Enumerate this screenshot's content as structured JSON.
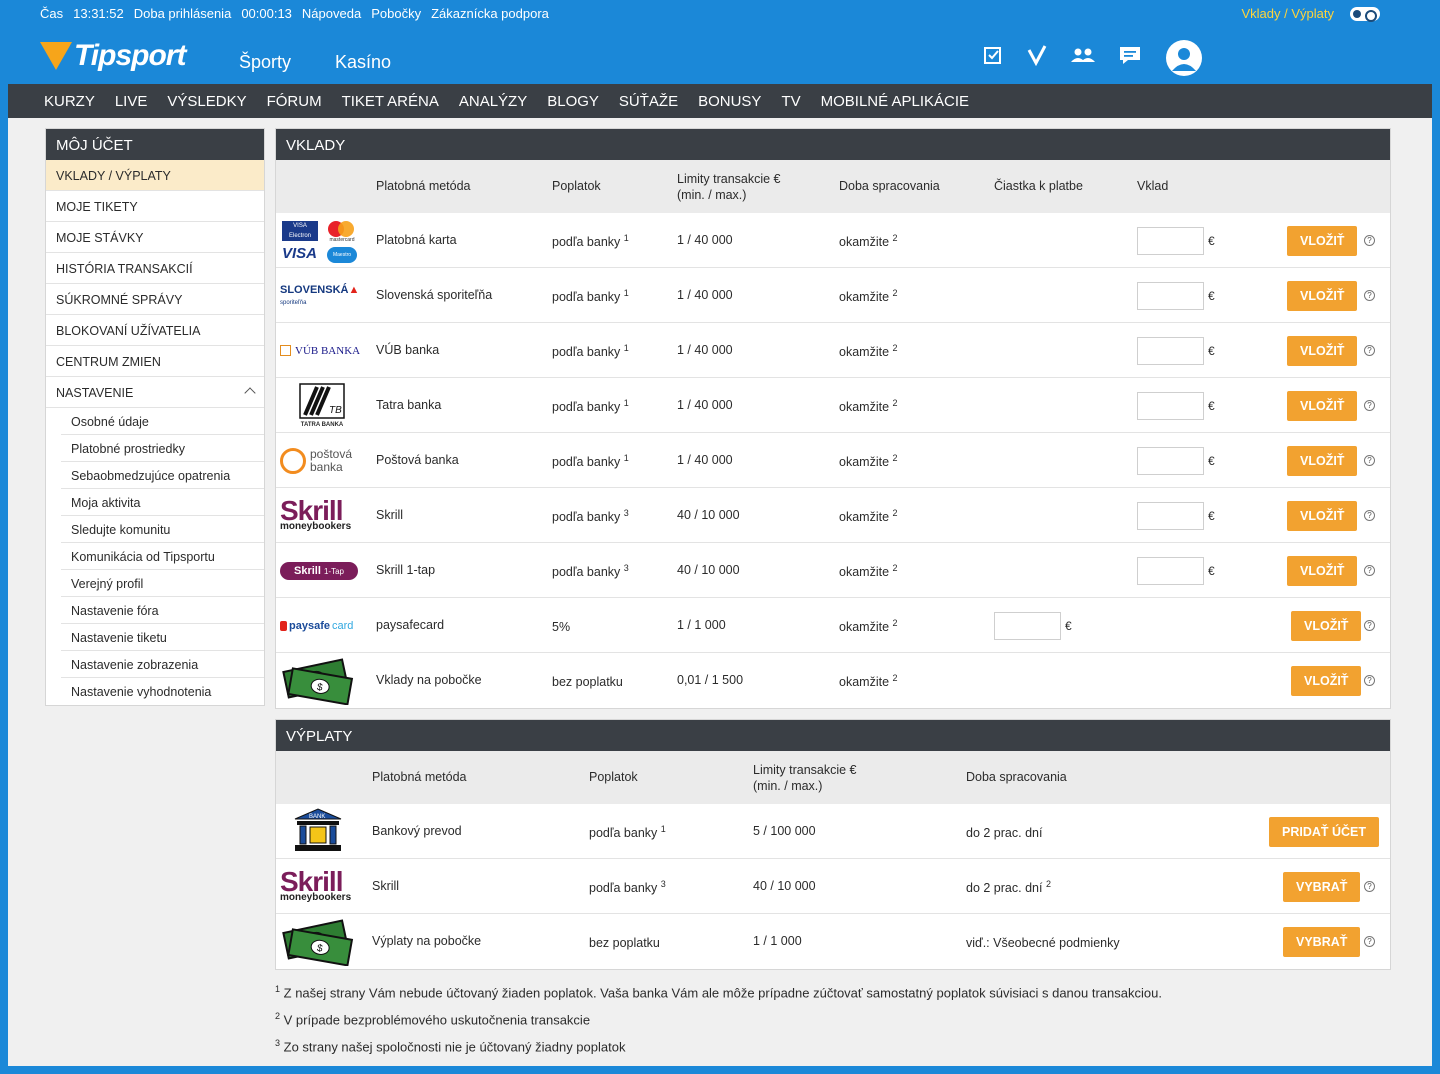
{
  "topbar": {
    "time_label": "Čas",
    "time_value": "13:31:52",
    "session_label": "Doba prihlásenia",
    "session_value": "00:00:13",
    "help": "Nápoveda",
    "branches": "Pobočky",
    "support": "Zákaznícka podpora",
    "deposits_link": "Vklady / Výplaty"
  },
  "logo": {
    "text": "Tipsport"
  },
  "mainnav": {
    "sports": "Športy",
    "casino": "Kasíno"
  },
  "subnav": [
    "KURZY",
    "LIVE",
    "VÝSLEDKY",
    "FÓRUM",
    "TIKET ARÉNA",
    "ANALÝZY",
    "BLOGY",
    "SÚŤAŽE",
    "BONUSY",
    "TV",
    "MOBILNÉ APLIKÁCIE"
  ],
  "sidebar": {
    "title": "MÔJ ÚČET",
    "items": [
      "VKLADY / VÝPLATY",
      "MOJE TIKETY",
      "MOJE STÁVKY",
      "HISTÓRIA TRANSAKCIÍ",
      "SÚKROMNÉ SPRÁVY",
      "BLOKOVANÍ UŽÍVATELIA",
      "CENTRUM ZMIEN",
      "NASTAVENIE"
    ],
    "subitems": [
      "Osobné údaje",
      "Platobné prostriedky",
      "Sebaobmedzujúce opatrenia",
      "Moja aktivita",
      "Sledujte komunitu",
      "Komunikácia od Tipsportu",
      "Verejný profil",
      "Nastavenie fóra",
      "Nastavenie tiketu",
      "Nastavenie zobrazenia",
      "Nastavenie vyhodnotenia"
    ]
  },
  "deposits": {
    "title": "VKLADY",
    "headers": {
      "method": "Platobná metóda",
      "fee": "Poplatok",
      "limits_line1": "Limity transakcie €",
      "limits_line2": "(min. / max.)",
      "processing": "Doba spracovania",
      "amount": "Čiastka k platbe",
      "deposit": "Vklad"
    },
    "rows": [
      {
        "logo": "card-logo",
        "method": "Platobná karta",
        "fee": "podľa banky",
        "fee_note": "1",
        "limits": "1 / 40 000",
        "processing": "okamžite",
        "proc_note": "2"
      },
      {
        "logo": "slsp-logo",
        "method": "Slovenská sporiteľňa",
        "fee": "podľa banky",
        "fee_note": "1",
        "limits": "1 / 40 000",
        "processing": "okamžite",
        "proc_note": "2"
      },
      {
        "logo": "vub-logo",
        "method": "VÚB banka",
        "fee": "podľa banky",
        "fee_note": "1",
        "limits": "1 / 40 000",
        "processing": "okamžite",
        "proc_note": "2"
      },
      {
        "logo": "tatra-logo",
        "method": "Tatra banka",
        "fee": "podľa banky",
        "fee_note": "1",
        "limits": "1 / 40 000",
        "processing": "okamžite",
        "proc_note": "2"
      },
      {
        "logo": "postova-logo",
        "method": "Poštová banka",
        "fee": "podľa banky",
        "fee_note": "1",
        "limits": "1 / 40 000",
        "processing": "okamžite",
        "proc_note": "2"
      },
      {
        "logo": "skrill-logo",
        "method": "Skrill",
        "fee": "podľa banky",
        "fee_note": "3",
        "limits": "40 / 10 000",
        "processing": "okamžite",
        "proc_note": "2"
      },
      {
        "logo": "skrill-1tap-logo",
        "method": "Skrill 1-tap",
        "fee": "podľa banky",
        "fee_note": "3",
        "limits": "40 / 10 000",
        "processing": "okamžite",
        "proc_note": "2"
      },
      {
        "logo": "paysafecard-logo",
        "method": "paysafecard",
        "fee": "5%",
        "fee_note": "",
        "limits": "1 / 1 000",
        "processing": "okamžite",
        "proc_note": "2"
      },
      {
        "logo": "cash-logo",
        "method": "Vklady na pobočke",
        "fee": "bez poplatku",
        "fee_note": "",
        "limits": "0,01 / 1 500",
        "processing": "okamžite",
        "proc_note": "2"
      }
    ],
    "currency": "€",
    "button_label": "VLOŽIŤ",
    "help_mark": "?"
  },
  "withdrawals": {
    "title": "VÝPLATY",
    "headers": {
      "method": "Platobná metóda",
      "fee": "Poplatok",
      "limits_line1": "Limity transakcie €",
      "limits_line2": "(min. / max.)",
      "processing": "Doba spracovania"
    },
    "rows": [
      {
        "logo": "bank-logo",
        "method": "Bankový prevod",
        "fee": "podľa banky",
        "fee_note": "1",
        "limits": "5 / 100 000",
        "processing": "do 2 prac. dní",
        "proc_note": "",
        "button": "PRIDAŤ ÚČET"
      },
      {
        "logo": "skrill-logo",
        "method": "Skrill",
        "fee": "podľa banky",
        "fee_note": "3",
        "limits": "40 / 10 000",
        "processing": "do 2 prac. dní",
        "proc_note": "2",
        "button": "VYBRAŤ"
      },
      {
        "logo": "cash-logo",
        "method": "Výplaty na pobočke",
        "fee": "bez poplatku",
        "fee_note": "",
        "limits": "1 / 1 000",
        "processing": "viď.: Všeobecné podmienky",
        "proc_note": "",
        "button": "VYBRAŤ"
      }
    ]
  },
  "notes": [
    {
      "mark": "1",
      "text": "Z našej strany Vám nebude účtovaný žiaden poplatok. Vaša banka Vám ale môže prípadne zúčtovať samostatný poplatok súvisiaci s danou transakciou."
    },
    {
      "mark": "2",
      "text": "V prípade bezproblémového uskutočnenia transakcie"
    },
    {
      "mark": "3",
      "text": "Zo strany našej spoločnosti nie je účtovaný žiadny poplatok"
    }
  ],
  "logo_text": {
    "visa": "VISA",
    "visa_electron": "VISA Electron",
    "mastercard": "mastercard",
    "maestro": "Maestro",
    "slsp": "SLOVENSKÁ",
    "slsp_sub": "sporiteľňa",
    "vub": "VÚB BANKA",
    "tatra": "TATRA BANKA",
    "postova1": "poštová",
    "postova2": "banka",
    "skrill": "Skrill",
    "moneybookers": "moneybookers",
    "skrill_1tap": "Skrill",
    "onetap": "1-Tap",
    "paysafe": "paysafe",
    "paysafe_card": "card",
    "bank": "BANK"
  },
  "colors": {
    "brand_blue": "#1b88d8",
    "accent_orange": "#f2a230",
    "dark_header": "#3a3f45",
    "active_row": "#fbebc9",
    "skrill": "#7b1d5a"
  }
}
